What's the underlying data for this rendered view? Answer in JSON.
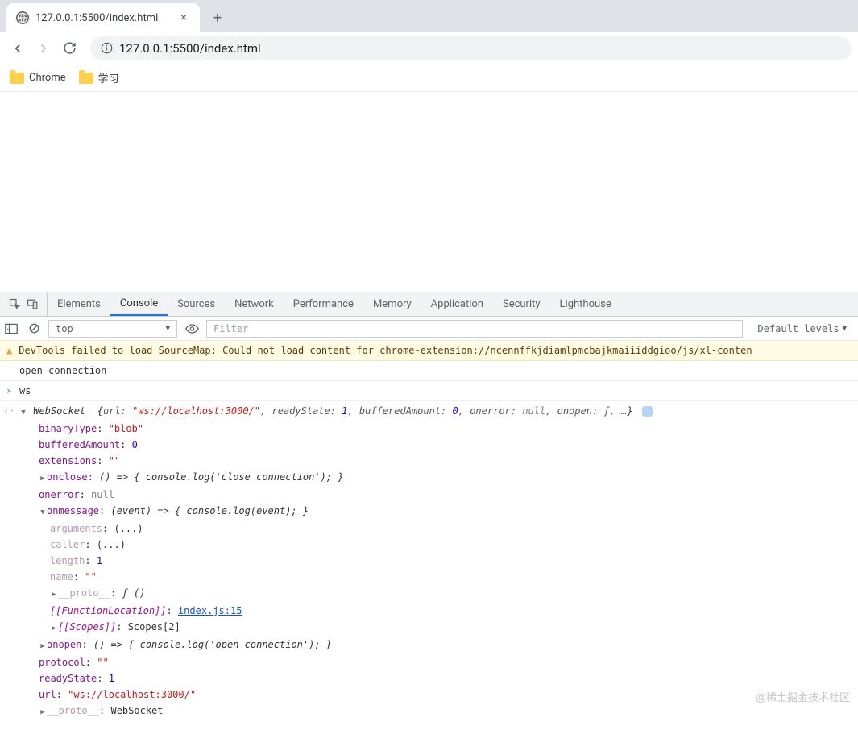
{
  "browser": {
    "tab_title": "127.0.0.1:5500/index.html",
    "url": "127.0.0.1:5500/index.html"
  },
  "bookmarks": [
    {
      "label": "Chrome"
    },
    {
      "label": "学习"
    }
  ],
  "devtools": {
    "tabs": [
      "Elements",
      "Console",
      "Sources",
      "Network",
      "Performance",
      "Memory",
      "Application",
      "Security",
      "Lighthouse"
    ],
    "active_tab": "Console",
    "context": "top",
    "filter_placeholder": "Filter",
    "levels": "Default levels"
  },
  "warning": {
    "text": "DevTools failed to load SourceMap: Could not load content for ",
    "link": "chrome-extension://ncennffkjdiamlpmcbajkmaiiiddgioo/js/xl-conten"
  },
  "console": {
    "log1": "open connection",
    "input": "ws",
    "summary": {
      "type": "WebSocket",
      "url_k": "url:",
      "url_v": "\"ws://localhost:3000/\"",
      "rs_k": "readyState:",
      "rs_v": "1",
      "ba_k": "bufferedAmount:",
      "ba_v": "0",
      "oe_k": "onerror:",
      "oe_v": "null",
      "oo_k": "onopen:",
      "oo_v": "ƒ",
      "rest": "…"
    },
    "props": {
      "binaryType_k": "binaryType",
      "binaryType_v": "\"blob\"",
      "bufferedAmount_k": "bufferedAmount",
      "bufferedAmount_v": "0",
      "extensions_k": "extensions",
      "extensions_v": "\"\"",
      "onclose_k": "onclose",
      "onclose_v": "() => { console.log('close connection'); }",
      "onerror_k": "onerror",
      "onerror_v": "null",
      "onmessage_k": "onmessage",
      "onmessage_v": "(event) => { console.log(event); }",
      "arguments_k": "arguments",
      "arguments_v": "(...)",
      "caller_k": "caller",
      "caller_v": "(...)",
      "length_k": "length",
      "length_v": "1",
      "name_k": "name",
      "name_v": "\"\"",
      "fnproto_k": "__proto__",
      "fnproto_v": "ƒ ()",
      "funcloc_k": "[[FunctionLocation]]",
      "funcloc_v": "index.js:15",
      "scopes_k": "[[Scopes]]",
      "scopes_v": "Scopes[2]",
      "onopen_k": "onopen",
      "onopen_v": "() => { console.log('open connection'); }",
      "protocol_k": "protocol",
      "protocol_v": "\"\"",
      "readyState_k": "readyState",
      "readyState_v": "1",
      "url_k": "url",
      "url_v": "\"ws://localhost:3000/\"",
      "proto_k": "__proto__",
      "proto_v": "WebSocket"
    }
  },
  "watermark": "@稀土掘金技术社区"
}
